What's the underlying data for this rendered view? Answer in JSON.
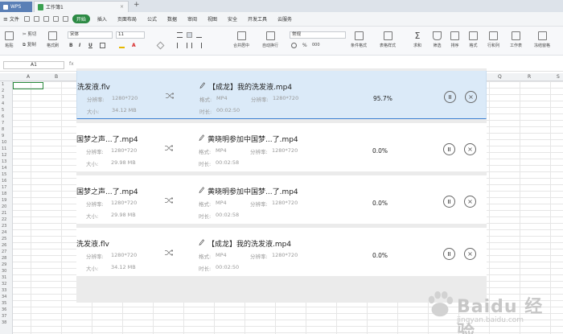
{
  "titlebar": {
    "app_tab": "WPS",
    "doc_tab": "工作簿1",
    "close": "×",
    "new_tab": "+"
  },
  "menubar": {
    "file": "文件",
    "start": "开始",
    "items": [
      "插入",
      "页面布局",
      "公式",
      "数据",
      "审阅",
      "视图",
      "安全",
      "开发工具",
      "云服务"
    ]
  },
  "ribbon": {
    "paste": "粘贴",
    "cut": "剪切",
    "copy": "复制",
    "format_painter": "格式刷",
    "font": "宋体",
    "font_size": "11",
    "bold": "B",
    "italic": "I",
    "underline": "U",
    "merge": "合并居中",
    "wrap": "自动换行",
    "number_format": "常规",
    "percent": "%",
    "thousands": "000",
    "cond_format": "条件格式",
    "table_style": "表格样式",
    "sum": "求和",
    "filter": "筛选",
    "sort": "排序",
    "format": "格式",
    "row_col": "行和列",
    "sheet": "工作表",
    "freeze": "冻结窗格"
  },
  "formula": {
    "cell_ref": "A1",
    "fx": "fx"
  },
  "columns": [
    "A",
    "B",
    "Q",
    "R",
    "S"
  ],
  "rows": [
    "1",
    "2",
    "3",
    "4",
    "5",
    "6",
    "7",
    "8",
    "9",
    "10",
    "11",
    "12",
    "13",
    "14",
    "15",
    "16",
    "17",
    "18",
    "19",
    "20",
    "21",
    "22",
    "23",
    "24",
    "25",
    "26",
    "27",
    "28",
    "29",
    "30",
    "31",
    "32",
    "33",
    "34",
    "35",
    "36",
    "37",
    "38"
  ],
  "converter": {
    "labels": {
      "resolution": "分辨率:",
      "size": "大小:",
      "format": "格式:",
      "duration": "时长:"
    },
    "tasks": [
      {
        "src_name": "洗发液.flv",
        "src_res": "1280*720",
        "src_size": "34.12 MB",
        "out_name": "【成龙】我的洗发液.mp4",
        "out_format": "MP4",
        "out_res": "1280*720",
        "out_duration": "00:02:50",
        "progress": "95.7%"
      },
      {
        "src_name": "国梦之声...了.mp4",
        "src_res": "1280*720",
        "src_size": "29.98 MB",
        "out_name": "黄晓明参加中国梦...了.mp4",
        "out_format": "MP4",
        "out_res": "1280*720",
        "out_duration": "00:02:58",
        "progress": "0.0%"
      },
      {
        "src_name": "国梦之声...了.mp4",
        "src_res": "1280*720",
        "src_size": "29.98 MB",
        "out_name": "黄晓明参加中国梦...了.mp4",
        "out_format": "MP4",
        "out_res": "1280*720",
        "out_duration": "00:02:58",
        "progress": "0.0%"
      },
      {
        "src_name": "洗发液.flv",
        "src_res": "1280*720",
        "src_size": "34.12 MB",
        "out_name": "【成龙】我的洗发液.mp4",
        "out_format": "MP4",
        "out_res": "1280*720",
        "out_duration": "00:02:50",
        "progress": "0.0%"
      }
    ]
  },
  "watermark": {
    "brand": "Baidu 经验",
    "sub": "jingyan.baidu.com"
  },
  "colors": {
    "active_card": "#dbeaf8",
    "active_border": "#3b7fd1",
    "start_green": "#2c8a44"
  }
}
